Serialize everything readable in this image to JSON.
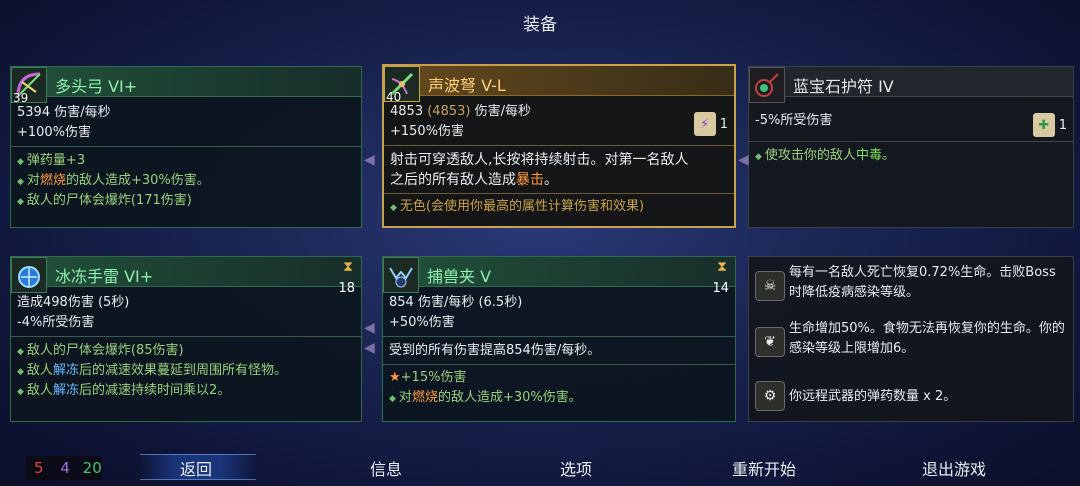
{
  "title": "装备",
  "cards": {
    "bow": {
      "level": "39",
      "name": "多头弓 VI+",
      "dps": "5394 伤害/每秒",
      "bonus": "+100%伤害",
      "affixes": [
        "弹药量+3",
        "对",
        "燃烧",
        "的敌人造成+30%伤害。",
        "敌人的尸体会爆炸(171伤害)"
      ]
    },
    "crossbow": {
      "level": "40",
      "name": "声波弩 V-L",
      "dps_a": "4853",
      "dps_b": "(4853)",
      "dps_c": "伤害/每秒",
      "bonus": "+150%伤害",
      "scroll_count": "1",
      "desc1": "射击可穿透敌人,长按将持续射击。对第一名敌人",
      "desc2a": "之后的所有敌人造成",
      "desc2b": "暴击",
      "desc2c": "。",
      "affix": "无色(会使用你最高的属性计算伤害和效果)"
    },
    "amulet": {
      "name": "蓝宝石护符 IV",
      "bonus": "-5%所受伤害",
      "scroll_count": "1",
      "affix_a": "使攻击你的敌人",
      "affix_b": "中毒",
      "affix_c": "。"
    },
    "grenade": {
      "name": "冰冻手雷 VI+",
      "cooldown": "18",
      "line1": "造成498伤害 (5秒)",
      "line2": "-4%所受伤害",
      "affixes": [
        "敌人的尸体会爆炸(85伤害)",
        "敌人",
        "解冻",
        "后的减速效果蔓延到周围所有怪物。",
        "敌人",
        "解冻",
        "后的减速持续时间乘以2。"
      ]
    },
    "trap": {
      "name": "捕兽夹 V",
      "cooldown": "14",
      "line1": "854 伤害/每秒 (6.5秒)",
      "line2": "+50%伤害",
      "line3": "受到的所有伤害提高854伤害/每秒。",
      "affix1": "+15%伤害",
      "affix2a": "对",
      "affix2b": "燃烧",
      "affix2c": "的敌人造成+30%伤害。"
    }
  },
  "mutations": [
    {
      "icon": "skull-heal-icon",
      "text": "每有一名敌人死亡恢复0.72%生命。击败Boss时降低疫病感染等级。"
    },
    {
      "icon": "vine-heart-icon",
      "text": "生命增加50%。食物无法再恢复你的生命。你的感染等级上限增加6。"
    },
    {
      "icon": "ammo-gear-icon",
      "text": "你远程武器的弹药数量 x 2。"
    }
  ],
  "scrolls": {
    "red": "5",
    "purple": "4",
    "green": "20"
  },
  "colors": {
    "red": "#e84040",
    "purple": "#a070e8",
    "green": "#40c870"
  },
  "nav": [
    "返回",
    "信息",
    "选项",
    "重新开始",
    "退出游戏"
  ]
}
